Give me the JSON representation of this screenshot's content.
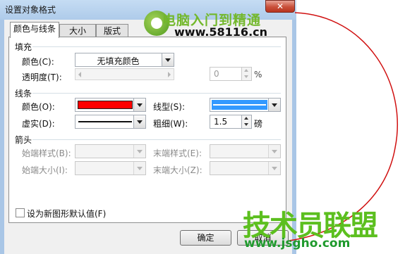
{
  "dialog": {
    "title": "设置对象格式",
    "close_glyph": "✕",
    "tabs": [
      {
        "label": "颜色与线条",
        "active": true
      },
      {
        "label": "大小",
        "active": false
      },
      {
        "label": "版式",
        "active": false
      }
    ]
  },
  "fill": {
    "group_title": "填充",
    "color_label": "颜色(C):",
    "color_value": "无填充颜色",
    "transparency_label": "透明度(T):",
    "transparency_value": "0",
    "transparency_unit": "%"
  },
  "line": {
    "group_title": "线条",
    "color_label": "颜色(O):",
    "color_value": "#ff0000",
    "style_label": "线型(S):",
    "style_color": "#3399ff",
    "dash_label": "虚实(D):",
    "weight_label": "粗细(W):",
    "weight_value": "1.5",
    "weight_unit": "磅"
  },
  "arrows": {
    "group_title": "箭头",
    "begin_style_label": "始端样式(B):",
    "end_style_label": "末端样式(E):",
    "begin_size_label": "始端大小(I):",
    "end_size_label": "末端大小(Z):"
  },
  "default_checkbox_label": "设为新图形默认值(F)",
  "buttons": {
    "ok": "确定",
    "cancel": "取消"
  },
  "watermarks": {
    "top_title": "电脑入门到精通",
    "top_url": "www.58116.cn",
    "bottom_title": "技术员联盟",
    "bottom_url": "www.jsgho.com"
  },
  "colors": {
    "title_bar": "#aecbea",
    "close_button": "#c9503a",
    "annotation_circle": "#d01010"
  }
}
